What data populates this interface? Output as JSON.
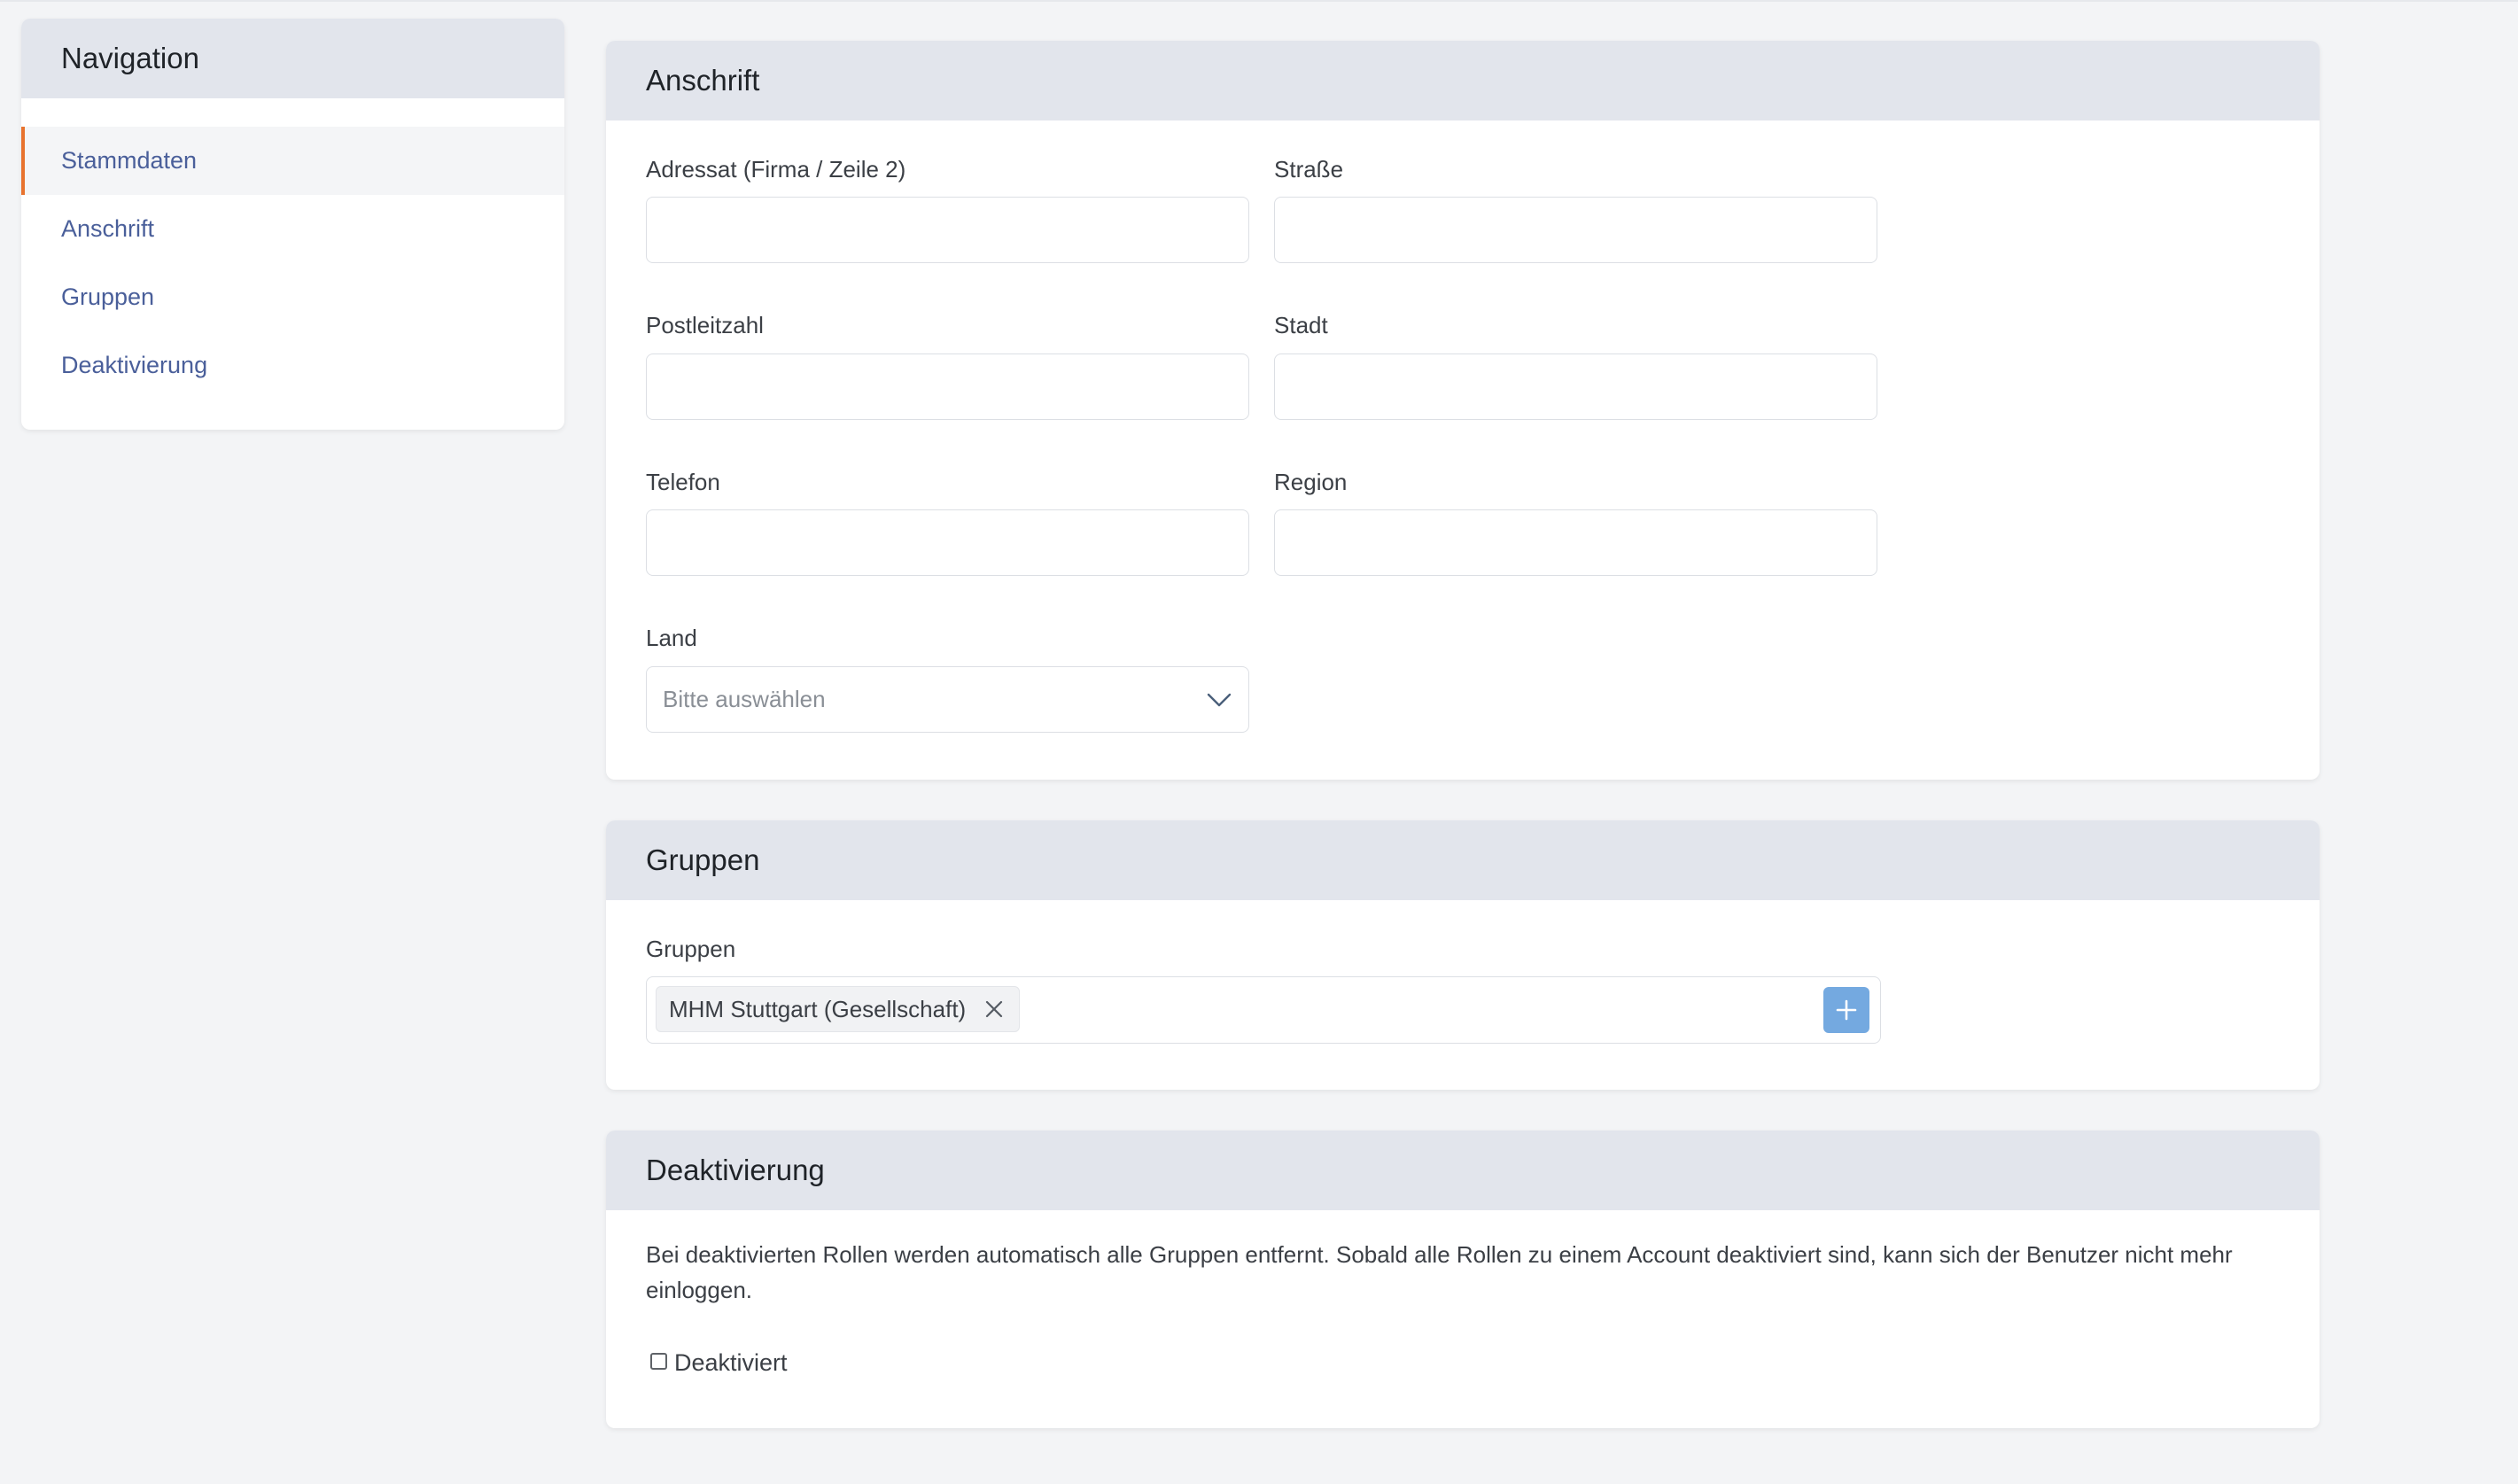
{
  "navigation": {
    "title": "Navigation",
    "items": [
      {
        "label": "Stammdaten",
        "active": true
      },
      {
        "label": "Anschrift",
        "active": false
      },
      {
        "label": "Gruppen",
        "active": false
      },
      {
        "label": "Deaktivierung",
        "active": false
      }
    ]
  },
  "address": {
    "title": "Anschrift",
    "fields": {
      "addressee": {
        "label": "Adressat (Firma / Zeile 2)",
        "value": ""
      },
      "street": {
        "label": "Straße",
        "value": ""
      },
      "postal_code": {
        "label": "Postleitzahl",
        "value": ""
      },
      "city": {
        "label": "Stadt",
        "value": ""
      },
      "phone": {
        "label": "Telefon",
        "value": ""
      },
      "region": {
        "label": "Region",
        "value": ""
      },
      "country": {
        "label": "Land",
        "placeholder": "Bitte auswählen",
        "icon": "chevron-down-icon"
      }
    }
  },
  "groups": {
    "title": "Gruppen",
    "field_label": "Gruppen",
    "tags": [
      "MHM Stuttgart (Gesellschaft)"
    ],
    "remove_icon": "close-icon",
    "add_icon": "plus-icon"
  },
  "deactivation": {
    "title": "Deaktivierung",
    "description": "Bei deaktivierten Rollen werden automatisch alle Gruppen entfernt. Sobald alle Rollen zu einem Account deaktiviert sind, kann sich der Benutzer nicht mehr einloggen.",
    "checkbox_label": "Deaktiviert",
    "checked": false
  },
  "colors": {
    "accent": "#e8732e",
    "link": "#4a5f9a",
    "header_bg": "#e2e5ec",
    "page_bg": "#f3f4f6",
    "add_button": "#74a9e0"
  }
}
